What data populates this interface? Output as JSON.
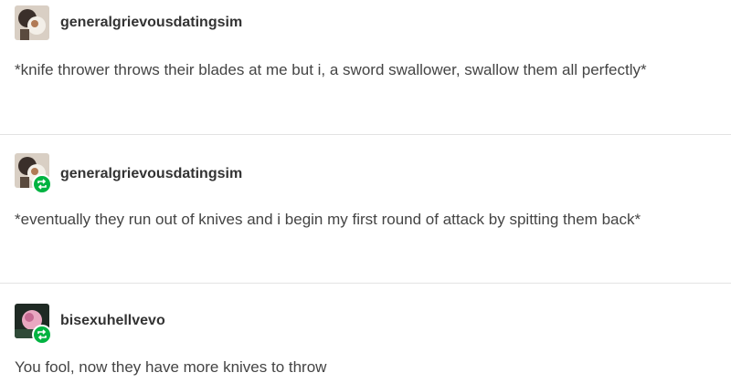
{
  "posts": [
    {
      "username": "generalgrievousdatingsim",
      "text": "*knife thrower throws their blades at me but i, a sword swallower, swallow them all perfectly*",
      "avatar_icon": "avatar-photo-icon",
      "reblog": false
    },
    {
      "username": "generalgrievousdatingsim",
      "text": "*eventually they run out of knives and i begin my first round of attack by spitting them back*",
      "avatar_icon": "avatar-photo-icon",
      "reblog": true
    },
    {
      "username": "bisexuhellvevo",
      "text": "You fool, now they have more knives to throw",
      "avatar_icon": "avatar-photo-icon",
      "reblog": true
    }
  ],
  "colors": {
    "reblog_badge": "#00b341",
    "divider": "#e3e3e3",
    "text": "#444444"
  }
}
